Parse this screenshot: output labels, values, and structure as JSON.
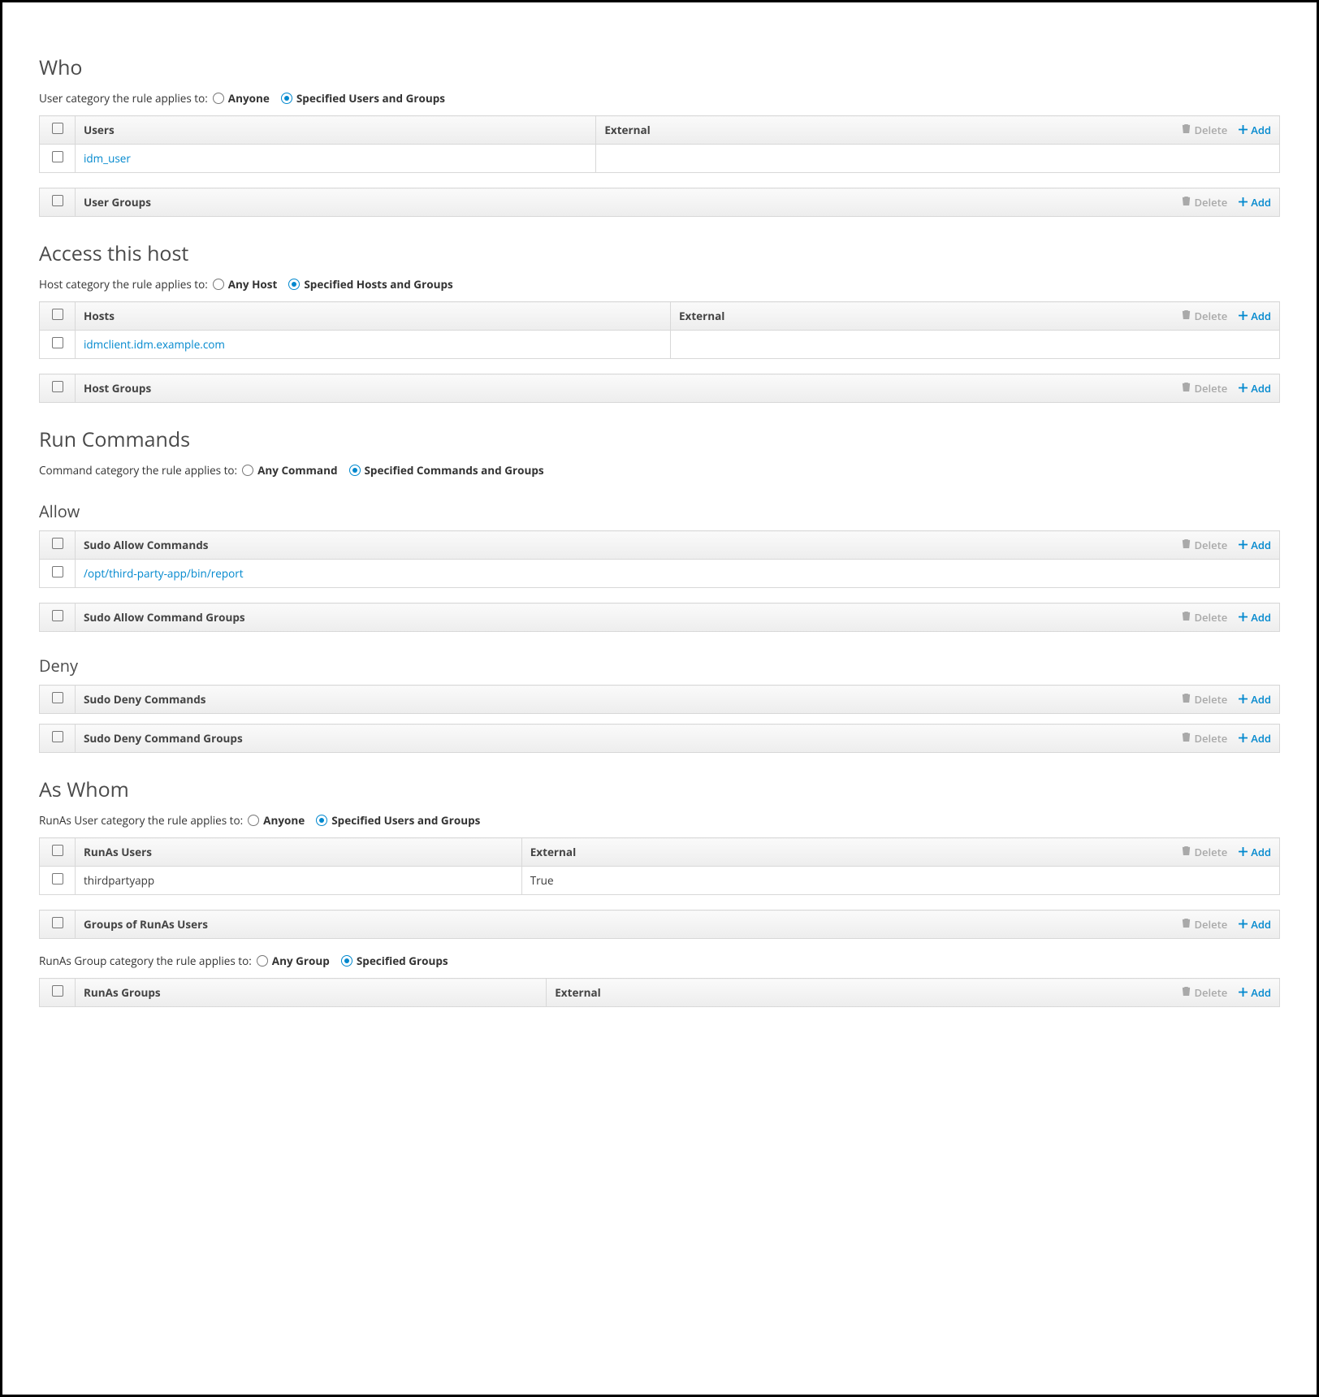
{
  "actions": {
    "delete": "Delete",
    "add": "Add"
  },
  "who": {
    "title": "Who",
    "category_label": "User category the rule applies to:",
    "radio_anyone": "Anyone",
    "radio_specified": "Specified Users and Groups",
    "users_table": {
      "col_users": "Users",
      "col_external": "External",
      "rows": [
        {
          "user": "idm_user"
        }
      ]
    },
    "user_groups_table": {
      "col_user_groups": "User Groups"
    }
  },
  "access_host": {
    "title": "Access this host",
    "category_label": "Host category the rule applies to:",
    "radio_any": "Any Host",
    "radio_specified": "Specified Hosts and Groups",
    "hosts_table": {
      "col_hosts": "Hosts",
      "col_external": "External",
      "rows": [
        {
          "host": "idmclient.idm.example.com"
        }
      ]
    },
    "host_groups_table": {
      "col_host_groups": "Host Groups"
    }
  },
  "run_commands": {
    "title": "Run Commands",
    "category_label": "Command category the rule applies to:",
    "radio_any": "Any Command",
    "radio_specified": "Specified Commands and Groups",
    "allow": {
      "title": "Allow",
      "commands_table": {
        "col": "Sudo Allow Commands",
        "rows": [
          {
            "cmd": "/opt/third-party-app/bin/report"
          }
        ]
      },
      "groups_table": {
        "col": "Sudo Allow Command Groups"
      }
    },
    "deny": {
      "title": "Deny",
      "commands_table": {
        "col": "Sudo Deny Commands"
      },
      "groups_table": {
        "col": "Sudo Deny Command Groups"
      }
    }
  },
  "as_whom": {
    "title": "As Whom",
    "user_category_label": "RunAs User category the rule applies to:",
    "user_radio_anyone": "Anyone",
    "user_radio_specified": "Specified Users and Groups",
    "runas_users_table": {
      "col_users": "RunAs Users",
      "col_external": "External",
      "rows": [
        {
          "user": "thirdpartyapp",
          "external": "True"
        }
      ]
    },
    "groups_of_runas_users_table": {
      "col": "Groups of RunAs Users"
    },
    "group_category_label": "RunAs Group category the rule applies to:",
    "group_radio_any": "Any Group",
    "group_radio_specified": "Specified Groups",
    "runas_groups_table": {
      "col_groups": "RunAs Groups",
      "col_external": "External"
    }
  }
}
